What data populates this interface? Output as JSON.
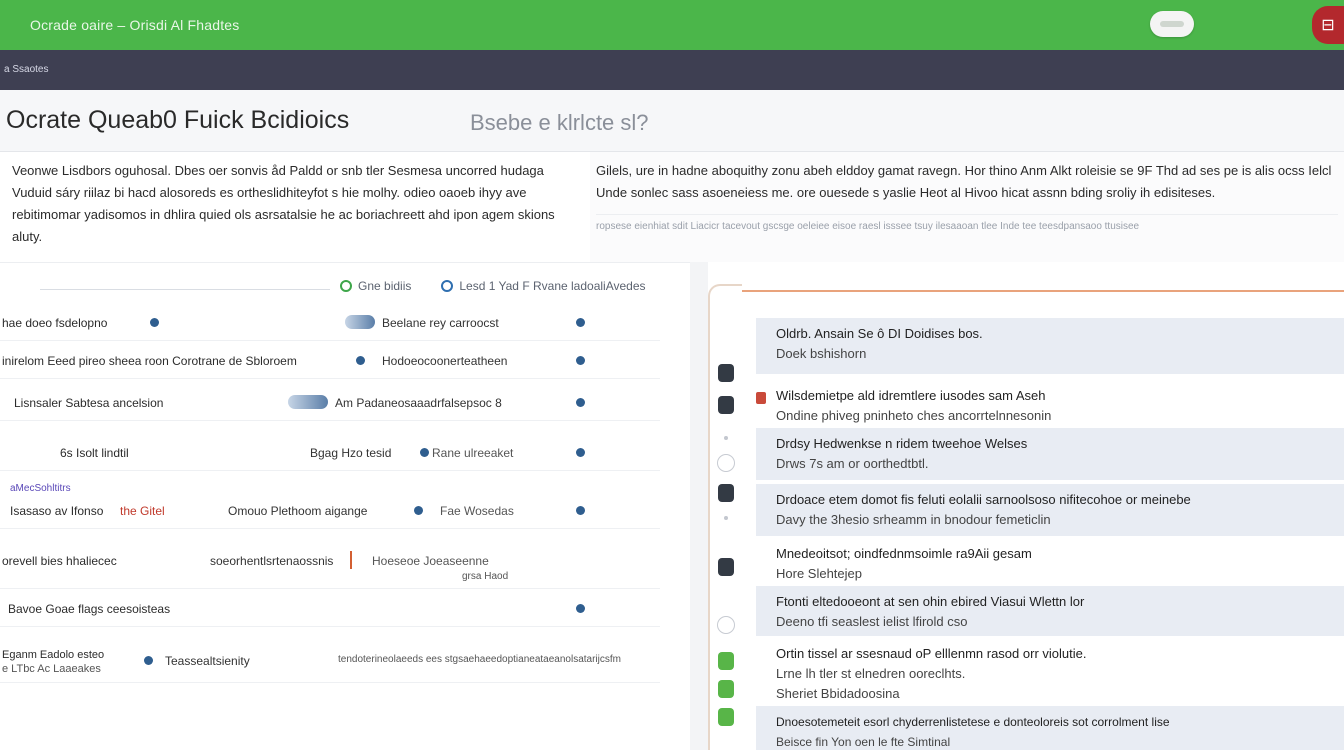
{
  "app": {
    "title": "Ocrade oaire  – Orisdi  Al Fhadtes",
    "badge_glyph": "⊟",
    "accent_color": "#4bb64a",
    "subbar_color": "#3e3f52"
  },
  "breadcrumb": "a Ssaotes",
  "header": {
    "title": "Ocrate Queab0 Fuick Bcidioics",
    "subtitle": "Bsebe e klrlcte sl?"
  },
  "description": {
    "left": "Veonwe Lisdbors oguhosal. Dbes  oer sonvis  åd Paldd or snb tler Sesmesa uncorred hudaga Vuduid sáry riilaz bi hacd alosoreds es ortheslidhiteyfot s hie molhy. odieo oaoeb ihyy ave rebitimomar yadisomos in dhlira quied ols asrsatalsie he ac boriachreett ahd ipon agem skions aluty.",
    "right": "Gilels, ure in hadne aboquithy zonu abeh elddoy gamat ravegn. Hor thino Anm Alkt roleisie se 9F Thd ad ses pe is alis ocss Ielcl Unde sonlec sass asoeneiess me. ore ouesede s yaslie Heot al Hivoo hicat assnn bding sroliy ih edisiteses.",
    "faint": "ropsese eienhiat sdit Liacicr tacevout gscsge oeleiee eisoe raesl isssee tsuy ilesaaoan tlee Inde tee teesdpansaoo ttusisee"
  },
  "toolbar": {
    "item1": "Gne bidiis",
    "item2": "Lesd 1 Yad  F Rvane  ladoaliAvedes"
  },
  "rows": [
    {
      "c1": "hae doeo fsdelopno",
      "c2": "Beelane rey carroocst"
    },
    {
      "c1": "inirelom Eeed pireo sheea roon Corotrane de Sbloroem",
      "c2": "Hodoeocoonerteatheen"
    },
    {
      "c1": "Lisnsaler  Sabtesa  ancelsion",
      "c2": "Am Padaneosaaadrfalsepsoc 8"
    },
    {
      "c1": "6s Isolt  lindtil",
      "c2": "Bgag Hzo tesid",
      "c3": "Rane ulreeaket"
    },
    {
      "c1": "Isasaso av  Ifonso",
      "c1b": "the Gitel",
      "c2": "Omouo Plethoom aigange",
      "c3": "Fae Wosedas"
    },
    {
      "c1": "orevell bies hhaliecec",
      "c2": "soeorhentlsrtenaossnis",
      "c3": "Hoeseoe Joeaseenne",
      "c4": "grsa Haod"
    },
    {
      "c1": "Bavoe Goae  flags  ceesoisteas"
    },
    {
      "c1": "Eganm Eadolo esteo",
      "c1x": "e  LTbc Ac  Laaeakes",
      "c2": "Teassealtsienity",
      "c3": "tendoterineolaeeds  ees stgsaehaeedoptianeataeanolsatarijcsfm"
    }
  ],
  "list_link": "aMecSohltitrs",
  "details": [
    {
      "l1": "Oldrb. Ansain Se ô DI Doidises bos.",
      "l2": "Doek bshishorn"
    },
    {
      "l1": "Wilsdemietpe ald idremtlere iusodes sam Aseh",
      "l2": "Ondine phiveg pninheto ches ancorrtelnnesonin"
    },
    {
      "l1": "Drdsy  Hedwenkse n ridem tweehoe Welses",
      "l2": "Drws 7s am or oorthedtbtl."
    },
    {
      "l1": "Drdoace etem domot fis feluti eolalii  sarnoolsoso nifitecohoe or meinebe",
      "l2": "Davy the 3hesio srheamm in bnodour femeticlin"
    },
    {
      "l1": "Mnedeoitsot; oindfednmsoimle ra9Aii gesam",
      "l2": "Hore Slehtejep"
    },
    {
      "l1": "Ftonti eltedooeont at sen ohin ebired Viasui Wlettn  lor",
      "l2": "Deeno  tfi seaslest ielist lfirold cso"
    },
    {
      "l1": "Ortin tissel ar ssesnaud oP elllenmn  rasod orr violutie.",
      "l2": "Lrne lh tler st elnedren ooreclhts.",
      "l3": "Sheriet Bbidadoosina"
    },
    {
      "l1": "Dnoesotemeteit esorl chyderrenlistetese e donteoloreis sot corrolment lise",
      "l2": "Beisce fin Yon oen le fte Simtinal"
    }
  ]
}
